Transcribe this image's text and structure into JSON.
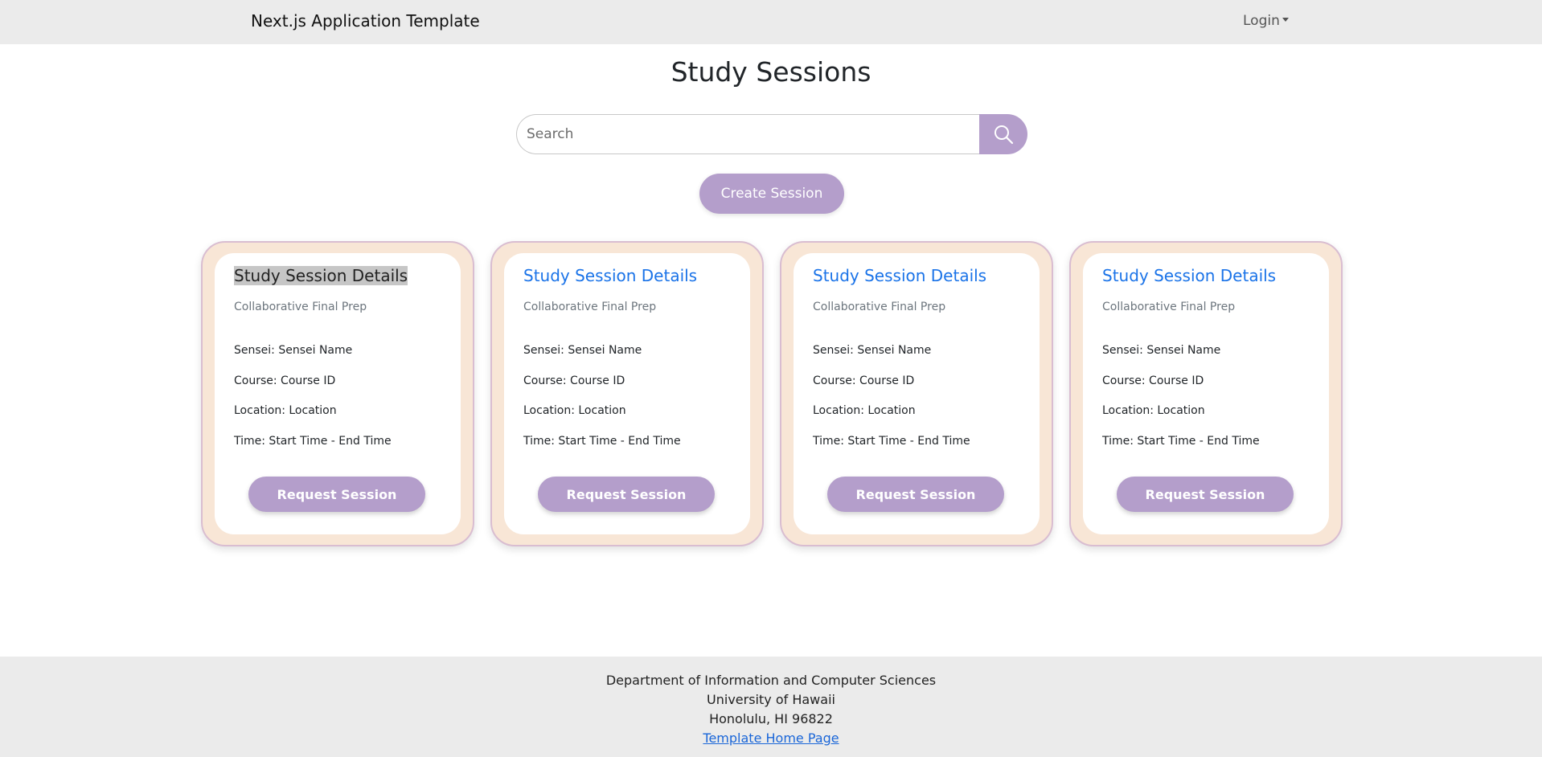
{
  "navbar": {
    "brand": "Next.js Application Template",
    "login_label": "Login"
  },
  "page": {
    "title": "Study Sessions"
  },
  "search": {
    "placeholder": "Search",
    "value": "",
    "icon": "search-icon"
  },
  "actions": {
    "create_label": "Create Session"
  },
  "colors": {
    "accent": "#b49ecb",
    "card_border_fill": "#f8e6d6",
    "link": "#1a73e8"
  },
  "cards": [
    {
      "title": "Study Session Details",
      "subtitle": "Collaborative Final Prep",
      "sensei": "Sensei: Sensei Name",
      "course": "Course: Course ID",
      "location": "Location: Location",
      "time": "Time: Start Time - End Time",
      "button": "Request Session"
    },
    {
      "title": "Study Session Details",
      "subtitle": "Collaborative Final Prep",
      "sensei": "Sensei: Sensei Name",
      "course": "Course: Course ID",
      "location": "Location: Location",
      "time": "Time: Start Time - End Time",
      "button": "Request Session"
    },
    {
      "title": "Study Session Details",
      "subtitle": "Collaborative Final Prep",
      "sensei": "Sensei: Sensei Name",
      "course": "Course: Course ID",
      "location": "Location: Location",
      "time": "Time: Start Time - End Time",
      "button": "Request Session"
    },
    {
      "title": "Study Session Details",
      "subtitle": "Collaborative Final Prep",
      "sensei": "Sensei: Sensei Name",
      "course": "Course: Course ID",
      "location": "Location: Location",
      "time": "Time: Start Time - End Time",
      "button": "Request Session"
    }
  ],
  "footer": {
    "line1": "Department of Information and Computer Sciences",
    "line2": "University of Hawaii",
    "line3": "Honolulu, HI 96822",
    "link": "Template Home Page"
  }
}
